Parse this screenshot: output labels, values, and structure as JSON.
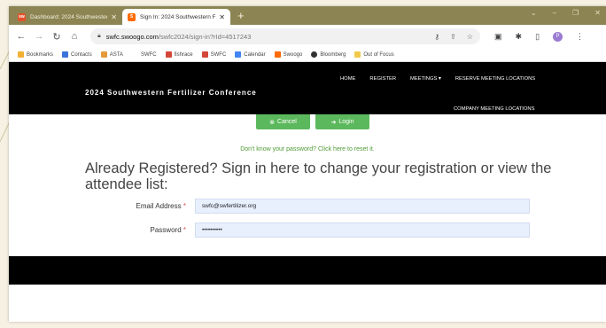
{
  "browser": {
    "tabs": [
      {
        "label": "Dashboard: 2024 Southwestern",
        "favicon": "sw-logo-icon"
      },
      {
        "label": "Sign In: 2024 Southwestern F",
        "favicon": "swoogo-icon"
      }
    ],
    "new_tab_symbol": "+",
    "url_host": "swfc.swoogo.com",
    "url_path": "/swfc2024/sign-in?rId=4517243"
  },
  "bookmarks": [
    {
      "label": "Bookmarks",
      "color": "#f2b134"
    },
    {
      "label": "Contacts",
      "color": "#3b73d9"
    },
    {
      "label": "ASTA",
      "color": "#e59a3a"
    },
    {
      "label": "SWFC",
      "color": "#ffffff"
    },
    {
      "label": "fishrace",
      "color": "#d44638"
    },
    {
      "label": "SWFC",
      "color": "#d44638"
    },
    {
      "label": "Calendar",
      "color": "#4285f4"
    },
    {
      "label": "Swoogo",
      "color": "#ff6a00"
    },
    {
      "label": "Bloomberg",
      "color": "#333333"
    },
    {
      "label": "Out of Focus",
      "color": "#f2c94c"
    }
  ],
  "site": {
    "title": "2024 Southwestern Fertilizer Conference",
    "nav": [
      "HOME",
      "REGISTER",
      "MEETINGS ▾",
      "RESERVE MEETING LOCATIONS"
    ],
    "subnav": "COMPANY MEETING LOCATIONS"
  },
  "form": {
    "cancel_label": "Cancel",
    "login_label": "Login",
    "forgot_text": "Don't know your password? Click here to reset it.",
    "heading": "Already Registered? Sign in here to change your registration or view the attendee list:",
    "email_label": "Email Address",
    "email_value": "swfc@swfertilizer.org",
    "password_label": "Password",
    "password_value": "••••••••••",
    "required_mark": "*"
  },
  "colors": {
    "accent_green": "#5cb85c",
    "tab_strip": "#8c8553",
    "header_bg": "#000000",
    "autofill_bg": "#e8f0fe"
  }
}
